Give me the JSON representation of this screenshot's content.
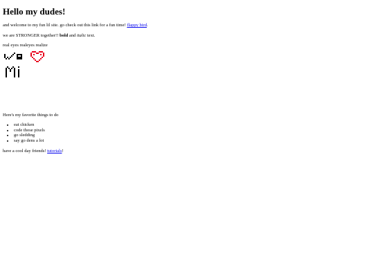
{
  "heading": "Hello my dudes!",
  "intro": {
    "text": "and welcome to my fun lil site. go check out this link for a fun time!",
    "link_text": "flappy bird",
    "suffix": "."
  },
  "strong_line": {
    "prefix": "we are STRONGER together!!",
    "bold": "bold",
    "middle": "and",
    "italic": "italic",
    "suffix": "text."
  },
  "realize_text": "real eyes realeyes realize",
  "pixel_art": {
    "color_ink": "#000000",
    "color_heart": "#e8001c"
  },
  "favorites": {
    "title": "Here's my favorite things to do",
    "items": [
      "eat chicken",
      "code those pixels",
      "go sledding",
      "say go dens a lot"
    ]
  },
  "closing": {
    "text": "have a cool day friends!",
    "link_text": "tutorials",
    "suffix": "!"
  }
}
